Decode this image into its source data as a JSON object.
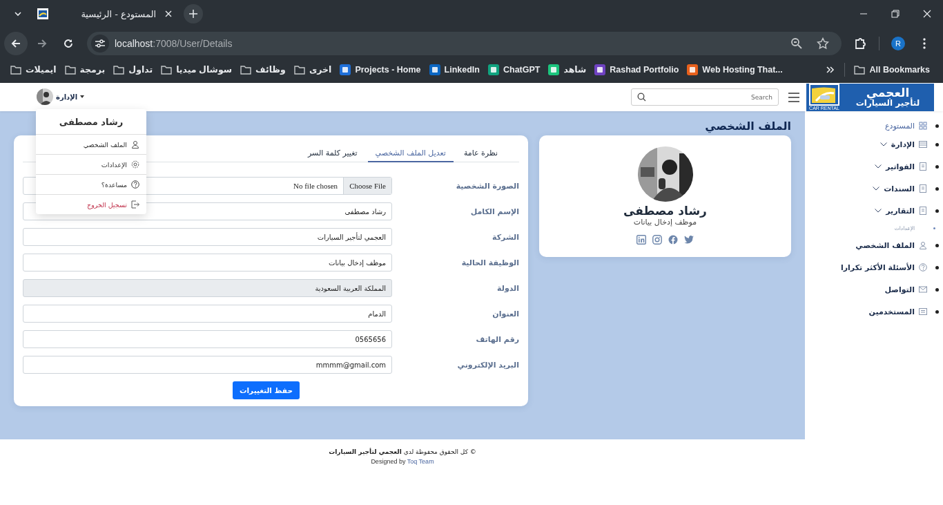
{
  "browser": {
    "tab_title": "المستودع - الرئيسية",
    "url_host": "localhost",
    "url_path": ":7008/User/Details",
    "profile_initial": "R",
    "bookmarks": [
      {
        "label": "Web Hosting That...",
        "kind": "site"
      },
      {
        "label": "Rashad Portfolio",
        "kind": "site"
      },
      {
        "label": "شاهد",
        "kind": "site"
      },
      {
        "label": "ChatGPT",
        "kind": "site"
      },
      {
        "label": "LinkedIn",
        "kind": "site"
      },
      {
        "label": "Projects - Home",
        "kind": "site"
      },
      {
        "label": "اخرى",
        "kind": "folder"
      },
      {
        "label": "وظائف",
        "kind": "folder"
      },
      {
        "label": "سوشال ميديا",
        "kind": "folder"
      },
      {
        "label": "تداول",
        "kind": "folder"
      },
      {
        "label": "برمجة",
        "kind": "folder"
      },
      {
        "label": "ايميلات",
        "kind": "folder"
      }
    ],
    "all_bookmarks": "All Bookmarks"
  },
  "header": {
    "logo_title": "العجمي",
    "logo_subtitle": "لتأجير السيارات",
    "logo_tag": "CAR RENTAL",
    "search": {
      "placeholder": "Search"
    },
    "user_menu": "الإدارة"
  },
  "user_dropdown": {
    "name": "رشاد مصطفى",
    "items": [
      {
        "label": "الملف الشخصي",
        "kind": "normal"
      },
      {
        "label": "الإعدادات",
        "kind": "normal"
      },
      {
        "label": "مساعدة؟",
        "kind": "normal"
      },
      {
        "label": "تسجيل الخروج",
        "kind": "danger"
      }
    ]
  },
  "sidebar": {
    "items": [
      {
        "label": "المستودع",
        "kind": "top",
        "has_submenu": false
      },
      {
        "label": "الإدارة",
        "kind": "link",
        "has_submenu": true
      },
      {
        "label": "الفواتير",
        "kind": "link",
        "has_submenu": true
      },
      {
        "label": "السندات",
        "kind": "link",
        "has_submenu": true
      },
      {
        "label": "التقارير",
        "kind": "link",
        "has_submenu": true
      },
      {
        "label": "الإعدادات",
        "kind": "heading",
        "has_submenu": false
      },
      {
        "label": "الملف الشخصي",
        "kind": "link",
        "has_submenu": false
      },
      {
        "label": "الأسئلة الأكثر تكرارا",
        "kind": "link",
        "has_submenu": false
      },
      {
        "label": "التواصل",
        "kind": "link",
        "has_submenu": false
      },
      {
        "label": "المستخدمين",
        "kind": "link",
        "has_submenu": false
      }
    ]
  },
  "page_title": "الملف الشخصي",
  "profile_card": {
    "name": "رشاد مصطفى",
    "job": "موظف إدخال بيانات"
  },
  "tabs": [
    {
      "label": "نظرة عامة",
      "selected": false
    },
    {
      "label": "تعديل الملف الشخصي",
      "selected": true
    },
    {
      "label": "تغيير كلمة السر",
      "selected": false
    }
  ],
  "form": [
    {
      "label": "الصورة الشخصية",
      "kind": "file",
      "button": "Choose File",
      "value": "No file chosen",
      "disabled": false
    },
    {
      "label": "الإسم الكامل",
      "kind": "text",
      "value": "رشاد مصطفى",
      "disabled": false
    },
    {
      "label": "الشركة",
      "kind": "text",
      "value": "العجمي لتأجير السيارات",
      "disabled": false
    },
    {
      "label": "الوظيفة الحالية",
      "kind": "text",
      "value": "موظف إدخال بيانات",
      "disabled": false
    },
    {
      "label": "الدولة",
      "kind": "text",
      "value": "المملكة العربية السعودية",
      "disabled": true
    },
    {
      "label": "العنوان",
      "kind": "text",
      "value": "الدمام",
      "disabled": false
    },
    {
      "label": "رقم الهاتف",
      "kind": "text",
      "value": "0565656",
      "disabled": false
    },
    {
      "label": "البريد الإلكتروني",
      "kind": "text",
      "value": "mmmm@gmail.com",
      "disabled": false
    }
  ],
  "save_button": "حفظ التغييرات",
  "footer": {
    "copyright": "© كل الحقوق محفوظة لدي **العجمي لتأجير السيارات**",
    "designed_by": "Designed by",
    "team_link": "Toq Team"
  }
}
